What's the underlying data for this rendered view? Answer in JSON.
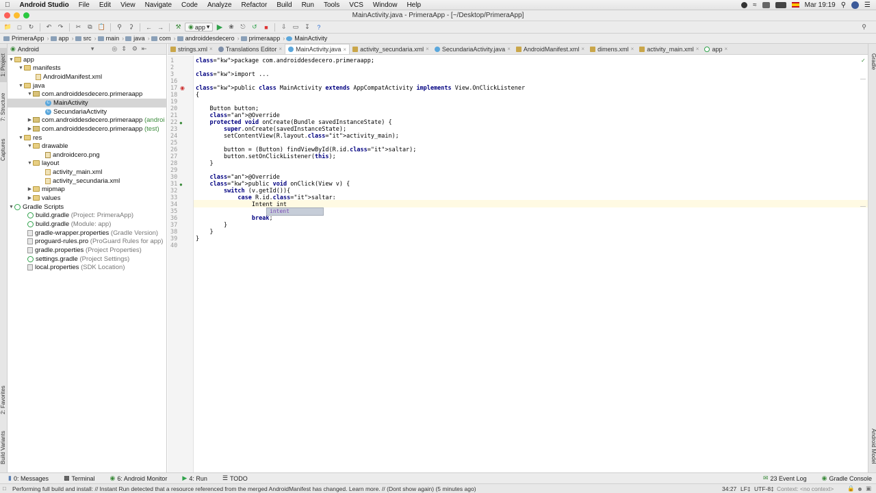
{
  "menubar": {
    "app": "Android Studio",
    "items": [
      "File",
      "Edit",
      "View",
      "Navigate",
      "Code",
      "Analyze",
      "Refactor",
      "Build",
      "Run",
      "Tools",
      "VCS",
      "Window",
      "Help"
    ],
    "clock": "Mar 19:19"
  },
  "window_title": "MainActivity.java - PrimeraApp - [~/Desktop/PrimeraApp]",
  "toolbar": {
    "run_config": "app"
  },
  "breadcrumbs": [
    "PrimeraApp",
    "app",
    "src",
    "main",
    "java",
    "com",
    "androiddesdecero",
    "primeraapp",
    "MainActivity"
  ],
  "project_panel": {
    "view": "Android",
    "tree": [
      {
        "label": "app",
        "extra": ""
      },
      {
        "label": "manifests",
        "extra": ""
      },
      {
        "label": "AndroidManifest.xml",
        "extra": ""
      },
      {
        "label": "java",
        "extra": ""
      },
      {
        "label": "com.androiddesdecero.primeraapp",
        "extra": ""
      },
      {
        "label": "MainActivity",
        "extra": ""
      },
      {
        "label": "SecundariaActivity",
        "extra": ""
      },
      {
        "label": "com.androiddesdecero.primeraapp",
        "extra": "(androi"
      },
      {
        "label": "com.androiddesdecero.primeraapp",
        "extra": "(test)"
      },
      {
        "label": "res",
        "extra": ""
      },
      {
        "label": "drawable",
        "extra": ""
      },
      {
        "label": "androidcero.png",
        "extra": ""
      },
      {
        "label": "layout",
        "extra": ""
      },
      {
        "label": "activity_main.xml",
        "extra": ""
      },
      {
        "label": "activity_secundaria.xml",
        "extra": ""
      },
      {
        "label": "mipmap",
        "extra": ""
      },
      {
        "label": "values",
        "extra": ""
      },
      {
        "label": "Gradle Scripts",
        "extra": ""
      },
      {
        "label": "build.gradle",
        "extra": "(Project: PrimeraApp)"
      },
      {
        "label": "build.gradle",
        "extra": "(Module: app)"
      },
      {
        "label": "gradle-wrapper.properties",
        "extra": "(Gradle Version)"
      },
      {
        "label": "proguard-rules.pro",
        "extra": "(ProGuard Rules for app)"
      },
      {
        "label": "gradle.properties",
        "extra": "(Project Properties)"
      },
      {
        "label": "settings.gradle",
        "extra": "(Project Settings)"
      },
      {
        "label": "local.properties",
        "extra": "(SDK Location)"
      }
    ]
  },
  "tabs": [
    "strings.xml",
    "Translations Editor",
    "MainActivity.java",
    "activity_secundaria.xml",
    "SecundariaActivity.java",
    "AndroidManifest.xml",
    "dimens.xml",
    "activity_main.xml",
    "app"
  ],
  "editor": {
    "line_numbers": [
      "1",
      "2",
      "3",
      "16",
      "17",
      "18",
      "19",
      "20",
      "21",
      "22",
      "23",
      "24",
      "25",
      "26",
      "27",
      "28",
      "29",
      "30",
      "31",
      "32",
      "33",
      "34",
      "35",
      "36",
      "37",
      "38",
      "39",
      "40"
    ],
    "lines": [
      "package com.androiddesdecero.primeraapp;",
      "",
      "import ...",
      "",
      "public class MainActivity extends AppCompatActivity implements View.OnClickListener",
      "{",
      "",
      "    Button button;",
      "    @Override",
      "    protected void onCreate(Bundle savedInstanceState) {",
      "        super.onCreate(savedInstanceState);",
      "        setContentView(R.layout.activity_main);",
      "",
      "        button = (Button) findViewById(R.id.saltar);",
      "        button.setOnClickListener(this);",
      "    }",
      "",
      "    @Override",
      "    public void onClick(View v) {",
      "        switch (v.getId()){",
      "            case R.id.saltar:",
      "                Intent int",
      "",
      "                break;",
      "        }",
      "    }",
      "}",
      ""
    ],
    "autocomplete": "intent"
  },
  "bottom_tabs": {
    "left": [
      "0: Messages",
      "Terminal",
      "6: Android Monitor",
      "4: Run",
      "TODO"
    ],
    "right": [
      "23 Event Log",
      "Gradle Console"
    ]
  },
  "status": {
    "message": "Performing full build and install: // Instant Run detected that a resource referenced from the merged AndroidManifest has changed. Learn more. // (Dont show again) (5 minutes ago)",
    "position": "34:27",
    "line_sep": "LF‡",
    "encoding": "UTF-8‡",
    "context": "Context: <no context>"
  },
  "side_tabs": {
    "left": [
      "1: Project",
      "7: Structure",
      "Captures",
      "2: Favorites",
      "Build Variants"
    ],
    "right": [
      "Gradle",
      "Android Model"
    ]
  }
}
